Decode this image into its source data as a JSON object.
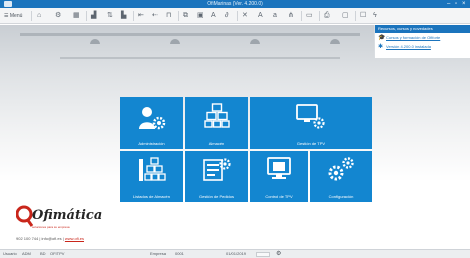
{
  "window": {
    "title": "OfiMarinas (Ver. 4.200.0)",
    "minimize": "–",
    "maximize": "▫",
    "close": "×"
  },
  "toolbar": {
    "menu_label": "☰ Menú"
  },
  "panel": {
    "title": "Recursos, cursos y novedades",
    "links": [
      {
        "icon": "graduation-cap-icon",
        "glyph": "🎓",
        "text": "Cursos y formación de Ofiforte"
      },
      {
        "icon": "info-icon",
        "glyph": "✱",
        "text": "Versión 4.200.0 instalada"
      }
    ]
  },
  "tiles": [
    {
      "key": "admin",
      "label": "Administración"
    },
    {
      "key": "almacen",
      "label": "Almacén"
    },
    {
      "key": "tpv",
      "label": "Gestión de TPV"
    },
    {
      "key": "listados",
      "label": "Listados de Almacén"
    },
    {
      "key": "pedidos",
      "label": "Gestión de Pedidos"
    },
    {
      "key": "control",
      "label": "Control de TPV"
    },
    {
      "key": "config",
      "label": "Configuración"
    }
  ],
  "brand": {
    "name": "Ofimática",
    "tagline": "soluciones para su empresa",
    "phone": "902 100 744",
    "email": "info@ofi.es",
    "website": "www.ofi.es"
  },
  "status": {
    "user_label": "Usuario",
    "user": "ADM",
    "db_label": "BD",
    "db": "OFITPV",
    "company_label": "Empresa",
    "company": "0001",
    "date": "01/01/2019"
  },
  "colors": {
    "accent": "#1386d0",
    "titlebar": "#1b74bd",
    "brand_red": "#c9261b"
  }
}
